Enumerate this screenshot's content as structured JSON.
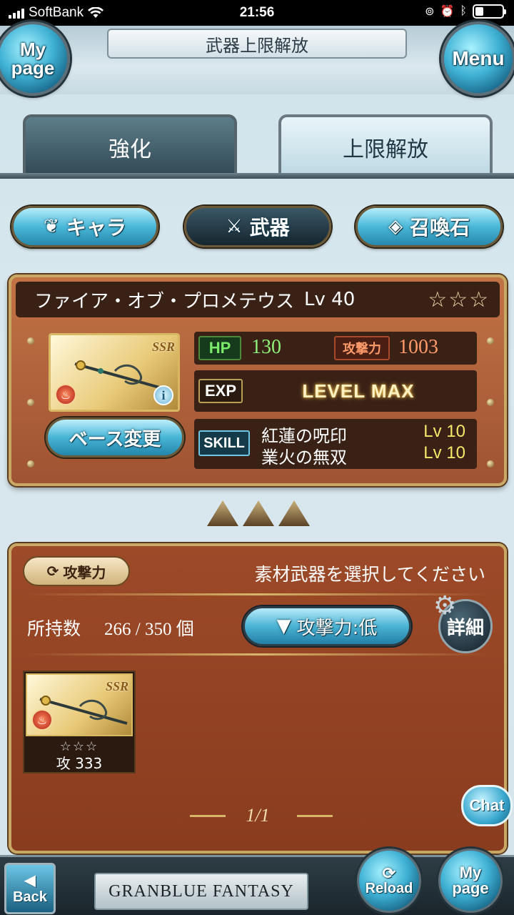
{
  "status_bar": {
    "carrier": "SoftBank",
    "time": "21:56",
    "icons": [
      "signal-icon",
      "wifi-icon",
      "orientation-lock-icon",
      "alarm-icon",
      "bluetooth-icon",
      "battery-icon"
    ]
  },
  "header": {
    "title": "武器上限解放",
    "mypage_label": "My page",
    "menu_label": "Menu"
  },
  "tabs": [
    {
      "label": "強化",
      "active": false
    },
    {
      "label": "上限解放",
      "active": true
    }
  ],
  "categories": {
    "chara": "キャラ",
    "weapon": "武器",
    "summon": "召喚石"
  },
  "weapon": {
    "name": "ファイア・オブ・プロメテウス",
    "level": "Lv 40",
    "stars": "☆☆☆",
    "rarity": "SSR",
    "hp_tag": "HP",
    "hp": "130",
    "atk_tag": "攻撃力",
    "atk": "1003",
    "exp_tag": "EXP",
    "exp_status": "LEVEL MAX",
    "base_change": "ベース変更",
    "skill_tag": "SKILL",
    "skills": [
      {
        "name": "紅蓮の呪印",
        "level": "Lv 10"
      },
      {
        "name": "業火の無双",
        "level": "Lv 10"
      }
    ]
  },
  "materials": {
    "filter_chip": "攻撃力",
    "prompt": "素材武器を選択してください",
    "owned_label": "所持数",
    "owned_count": "266 / 350 個",
    "sort_label": "攻撃力:低",
    "detail_label": "詳細",
    "items": [
      {
        "rarity": "SSR",
        "stars": "☆☆☆",
        "atk": "攻 333"
      }
    ],
    "page": "1/1"
  },
  "chat_label": "Chat",
  "footer": {
    "back_label": "Back",
    "brand": "GRANBLUE FANTASY",
    "reload_label": "Reload",
    "mypage_label": "My page"
  },
  "colors": {
    "accent_blue": "#3fb1d4",
    "panel_brown": "#9e5332",
    "gold_trim": "#c9a865",
    "hp_green": "#8ff07a",
    "atk_orange": "#ff9a6a",
    "skill_level_yellow": "#f5e76a"
  }
}
